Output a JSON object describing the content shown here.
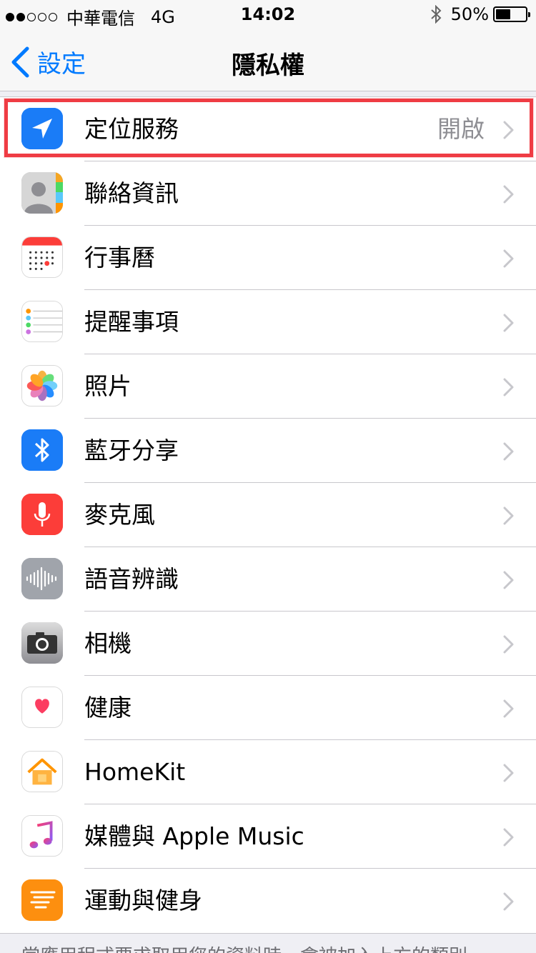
{
  "status_bar": {
    "carrier": "中華電信",
    "network": "4G",
    "time": "14:02",
    "battery_percent": "50%",
    "battery_level": 0.5,
    "signal_bars_filled": 2,
    "signal_bars_total": 5
  },
  "nav": {
    "back_label": "設定",
    "title": "隱私權"
  },
  "rows": [
    {
      "label": "定位服務",
      "value": "開啟",
      "icon": "location-arrow-icon",
      "color": "#1a7cf7"
    },
    {
      "label": "聯絡資訊",
      "value": "",
      "icon": "contacts-icon",
      "color": "#9b9b9b"
    },
    {
      "label": "行事曆",
      "value": "",
      "icon": "calendar-icon",
      "color": "#ffffff"
    },
    {
      "label": "提醒事項",
      "value": "",
      "icon": "reminders-icon",
      "color": "#ffffff"
    },
    {
      "label": "照片",
      "value": "",
      "icon": "photos-icon",
      "color": "#ffffff"
    },
    {
      "label": "藍牙分享",
      "value": "",
      "icon": "bluetooth-icon",
      "color": "#1a7cf7"
    },
    {
      "label": "麥克風",
      "value": "",
      "icon": "microphone-icon",
      "color": "#fc3d39"
    },
    {
      "label": "語音辨識",
      "value": "",
      "icon": "speech-waveform-icon",
      "color": "#a0a4ab"
    },
    {
      "label": "相機",
      "value": "",
      "icon": "camera-icon",
      "color": "#8e8e93"
    },
    {
      "label": "健康",
      "value": "",
      "icon": "health-heart-icon",
      "color": "#ffffff"
    },
    {
      "label": "HomeKit",
      "value": "",
      "icon": "homekit-house-icon",
      "color": "#ffffff"
    },
    {
      "label": "媒體與 Apple Music",
      "value": "",
      "icon": "music-note-icon",
      "color": "#ffffff"
    },
    {
      "label": "運動與健身",
      "value": "",
      "icon": "motion-fitness-icon",
      "color": "#fd8f0f"
    }
  ],
  "footer_note": "當應用程式要求取用您的資料時，會被加入上方的類別。"
}
